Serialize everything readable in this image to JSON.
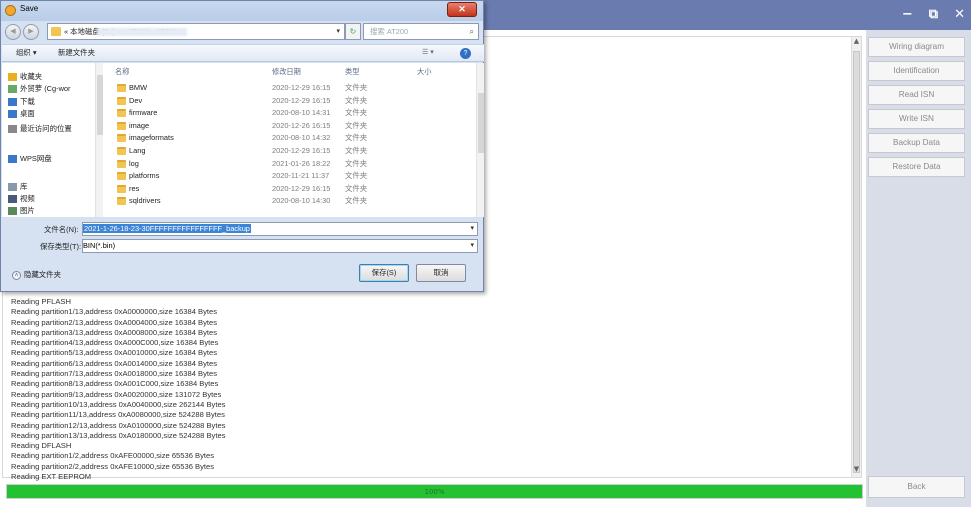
{
  "app": {
    "controls": {
      "minimize": "−",
      "restore": "⧉",
      "close": "✕"
    },
    "buttons": [
      "Wiring diagram",
      "Identification",
      "Read ISN",
      "Write ISN",
      "Backup Data",
      "Restore Data"
    ],
    "back": "Back",
    "progress": {
      "percent": 100,
      "label": "100%"
    },
    "log_lines": [
      "Reading PFLASH",
      "Reading partition1/13,address 0xA0000000,size 16384 Bytes",
      "Reading partition2/13,address 0xA0004000,size 16384 Bytes",
      "Reading partition3/13,address 0xA0008000,size 16384 Bytes",
      "Reading partition4/13,address 0xA000C000,size 16384 Bytes",
      "Reading partition5/13,address 0xA0010000,size 16384 Bytes",
      "Reading partition6/13,address 0xA0014000,size 16384 Bytes",
      "Reading partition7/13,address 0xA0018000,size 16384 Bytes",
      "Reading partition8/13,address 0xA001C000,size 16384 Bytes",
      "Reading partition9/13,address 0xA0020000,size 131072 Bytes",
      "Reading partition10/13,address 0xA0040000,size 262144 Bytes",
      "Reading partition11/13,address 0xA0080000,size 524288 Bytes",
      "Reading partition12/13,address 0xA0100000,size 524288 Bytes",
      "Reading partition13/13,address 0xA0180000,size 524288 Bytes",
      "Reading DFLASH",
      "Reading partition1/2,address 0xAFE00000,size 65536 Bytes",
      "Reading partition2/2,address 0xAFE10000,size 65536 Bytes",
      "Reading EXT EEPROM"
    ]
  },
  "dialog": {
    "title": "Save",
    "close": "✕",
    "back_btn": "◀",
    "fwd_btn": "▶",
    "address": "« 本地磁盘 (D:) ▸                       ▸ AT200 ▸ AT200 ▸",
    "address_drop": "▾",
    "refresh": "↻",
    "search_placeholder": "搜索 AT200",
    "search_icon": "⌕",
    "toolbar": {
      "organize": "组织 ▾",
      "new_folder": "新建文件夹",
      "view": "☰ ▾",
      "help": "?"
    },
    "nav_items": [
      {
        "label": "收藏夹",
        "icon": "star-icon",
        "color": "#e8b020"
      },
      {
        "label": "外贸萝 (Cg-wor",
        "icon": "user-icon",
        "color": "#6aa86a"
      },
      {
        "label": "下载",
        "icon": "download-icon",
        "color": "#3a78c9"
      },
      {
        "label": "桌面",
        "icon": "desktop-icon",
        "color": "#3a78c9"
      },
      {
        "label": "最近访问的位置",
        "icon": "recent-icon",
        "color": "#888"
      },
      {
        "label": "WPS网盘",
        "icon": "cloud-icon",
        "color": "#3a78c9"
      },
      {
        "label": "库",
        "icon": "library-icon",
        "color": "#8899aa"
      },
      {
        "label": "视频",
        "icon": "video-icon",
        "color": "#4a5a7a"
      },
      {
        "label": "图片",
        "icon": "picture-icon",
        "color": "#5a8a5a"
      }
    ],
    "columns": {
      "name": "名称",
      "date": "修改日期",
      "type": "类型",
      "size": "大小"
    },
    "files": [
      {
        "name": "BMW",
        "date": "2020-12-29 16:15",
        "type": "文件夹"
      },
      {
        "name": "Dev",
        "date": "2020-12-29 16:15",
        "type": "文件夹"
      },
      {
        "name": "firmware",
        "date": "2020-08-10 14:31",
        "type": "文件夹"
      },
      {
        "name": "image",
        "date": "2020-12-26 16:15",
        "type": "文件夹"
      },
      {
        "name": "imageformats",
        "date": "2020-08-10 14:32",
        "type": "文件夹"
      },
      {
        "name": "Lang",
        "date": "2020-12-29 16:15",
        "type": "文件夹"
      },
      {
        "name": "log",
        "date": "2021-01-26 18:22",
        "type": "文件夹"
      },
      {
        "name": "platforms",
        "date": "2020-11-21 11:37",
        "type": "文件夹"
      },
      {
        "name": "res",
        "date": "2020-12-29 16:15",
        "type": "文件夹"
      },
      {
        "name": "sqldrivers",
        "date": "2020-08-10 14:30",
        "type": "文件夹"
      }
    ],
    "filename_label": "文件名(N):",
    "filename_value": "2021-1-26-18-23-30FFFFFFFFFFFFFFFF_backup",
    "filetype_label": "保存类型(T):",
    "filetype_value": "BIN(*.bin)",
    "hide_folders": "隐藏文件夹",
    "save_btn": "保存(S)",
    "cancel_btn": "取消"
  }
}
